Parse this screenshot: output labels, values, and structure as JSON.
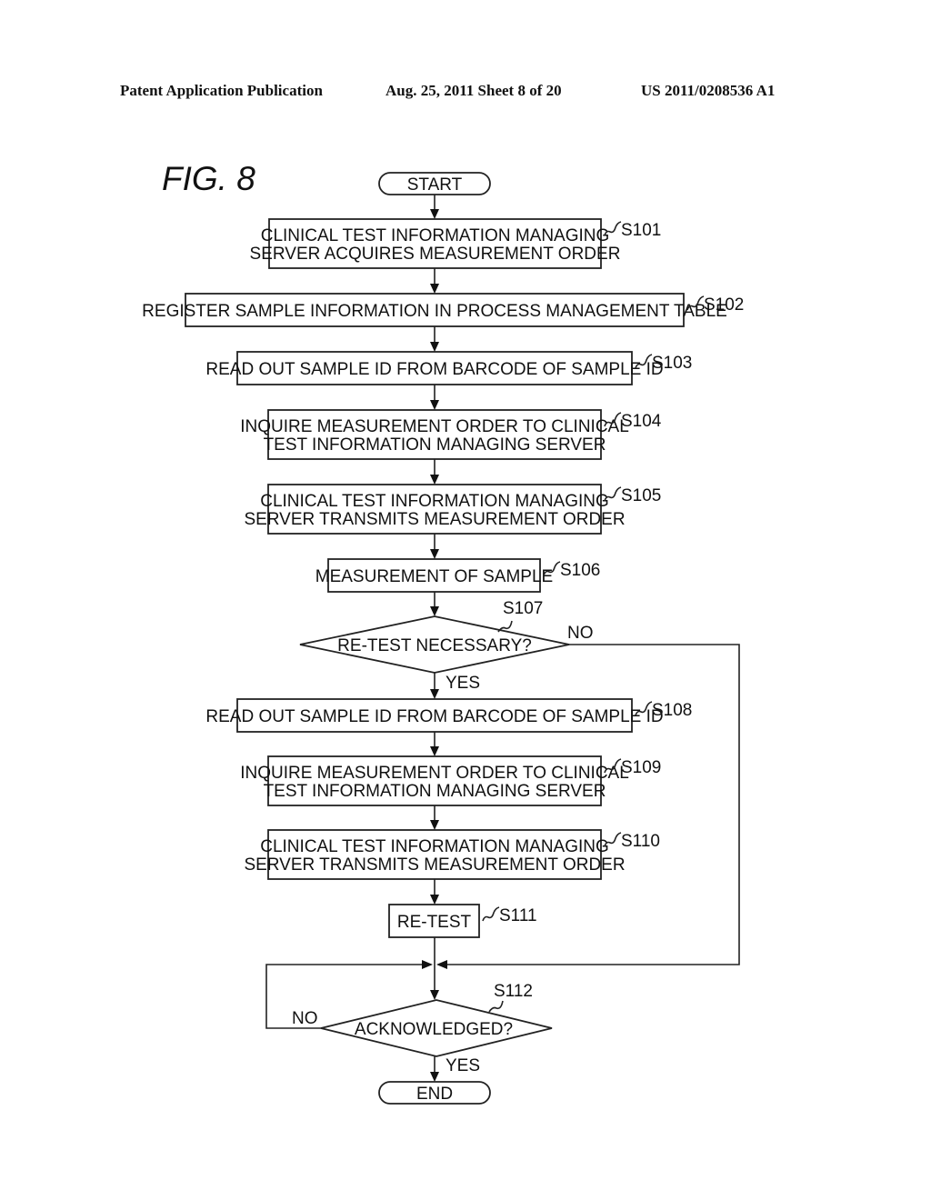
{
  "header": {
    "publication": "Patent Application Publication",
    "date_sheet": "Aug. 25, 2011  Sheet 8 of 20",
    "number": "US 2011/0208536 A1"
  },
  "figure_label": "FIG. 8",
  "flowchart": {
    "start": "START",
    "end": "END",
    "steps": [
      {
        "id": "S101",
        "lines": [
          "CLINICAL TEST INFORMATION MANAGING",
          "SERVER ACQUIRES MEASUREMENT ORDER"
        ]
      },
      {
        "id": "S102",
        "lines": [
          "REGISTER SAMPLE INFORMATION IN PROCESS MANAGEMENT TABLE"
        ]
      },
      {
        "id": "S103",
        "lines": [
          "READ OUT SAMPLE ID FROM BARCODE OF SAMPLE ID"
        ]
      },
      {
        "id": "S104",
        "lines": [
          "INQUIRE MEASUREMENT ORDER TO CLINICAL",
          "TEST INFORMATION MANAGING SERVER"
        ]
      },
      {
        "id": "S105",
        "lines": [
          "CLINICAL TEST INFORMATION MANAGING",
          "SERVER TRANSMITS MEASUREMENT ORDER"
        ]
      },
      {
        "id": "S106",
        "lines": [
          "MEASUREMENT OF SAMPLE"
        ]
      },
      {
        "id": "S107",
        "lines": [
          "RE-TEST NECESSARY?"
        ],
        "decision": true,
        "yes": "YES",
        "no": "NO"
      },
      {
        "id": "S108",
        "lines": [
          "READ OUT SAMPLE ID FROM BARCODE OF SAMPLE ID"
        ]
      },
      {
        "id": "S109",
        "lines": [
          "INQUIRE MEASUREMENT ORDER TO CLINICAL",
          "TEST INFORMATION MANAGING SERVER"
        ]
      },
      {
        "id": "S110",
        "lines": [
          "CLINICAL TEST INFORMATION MANAGING",
          "SERVER TRANSMITS MEASUREMENT ORDER"
        ]
      },
      {
        "id": "S111",
        "lines": [
          "RE-TEST"
        ]
      },
      {
        "id": "S112",
        "lines": [
          "ACKNOWLEDGED?"
        ],
        "decision": true,
        "yes": "YES",
        "no": "NO"
      }
    ]
  }
}
